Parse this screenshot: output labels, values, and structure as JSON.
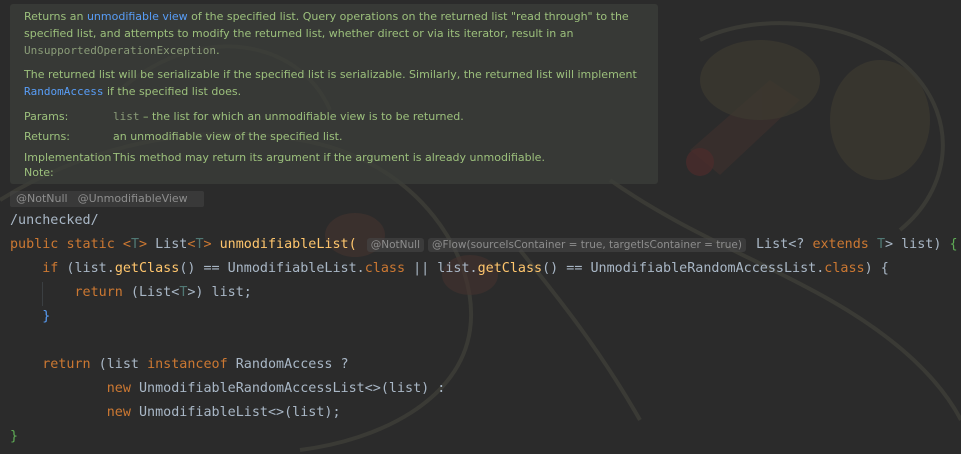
{
  "doc": {
    "para1": {
      "t1": "Returns an ",
      "link": "unmodifiable view",
      "t2": " of the specified list. Query operations on the returned list \"read through\" to the specified list, and attempts to modify the returned list, whether direct or via its iterator, result in an ",
      "code": "UnsupportedOperationException",
      "t3": "."
    },
    "para2": {
      "t1": "The returned list will be serializable if the specified list is serializable. Similarly, the returned list will implement ",
      "code": "RandomAccess",
      "t2": " if the specified list does."
    },
    "params_key": "Params:",
    "params_code": "list",
    "params_text": " – the list for which an unmodifiable view is to be returned.",
    "returns_key": "Returns:",
    "returns_text": "an unmodifiable view of the specified list.",
    "impl_key_1": "Implementation",
    "impl_key_2": "Note:",
    "impl_text": "This method may return its argument if the argument is already unmodifiable."
  },
  "annotations": {
    "a1": "@NotNull",
    "a2": "@UnmodifiableView"
  },
  "code": {
    "comment": "/unchecked/",
    "sig_public": "public",
    "sig_static": "static",
    "sig_lt": "<",
    "sig_T": "T",
    "sig_gt": ">",
    "sig_list": "List",
    "sig_lt2": "<",
    "sig_T2": "T",
    "sig_gt2": ">",
    "sig_method": "unmodifiableList",
    "sig_paren": "(",
    "hint_notnull": "@NotNull",
    "hint_flow": "@Flow(sourceIsContainer = true, targetIsContainer = true)",
    "sig_list2": "List",
    "sig_wild": "<? ",
    "sig_extends": "extends",
    "sig_T3": "T",
    "sig_param": "> list) ",
    "sig_brace": "{",
    "if_kw": "if",
    "if_body_1": " (list.",
    "if_getclass": "getClass",
    "if_body_2": "() == UnmodifiableList.",
    "if_class": "class",
    "if_body_3": " || list.",
    "if_getclass2": "getClass",
    "if_body_4": "() == UnmodifiableRandomAccessList.",
    "if_class2": "class",
    "if_body_5": ") {",
    "ret_kw": "return",
    "ret_body_1": " (List<",
    "ret_T": "T",
    "ret_body_2": ">) list;",
    "close_if": "}",
    "ret2_kw": "return",
    "ret2_body_1": " (list ",
    "instanceof_kw": "instanceof",
    "ret2_body_2": " RandomAccess ?",
    "new_kw": "new",
    "new_body_1": " UnmodifiableRandomAccessList<>(list) :",
    "new_kw2": "new",
    "new_body_2": " UnmodifiableList<>(list);",
    "close_method": "}"
  }
}
